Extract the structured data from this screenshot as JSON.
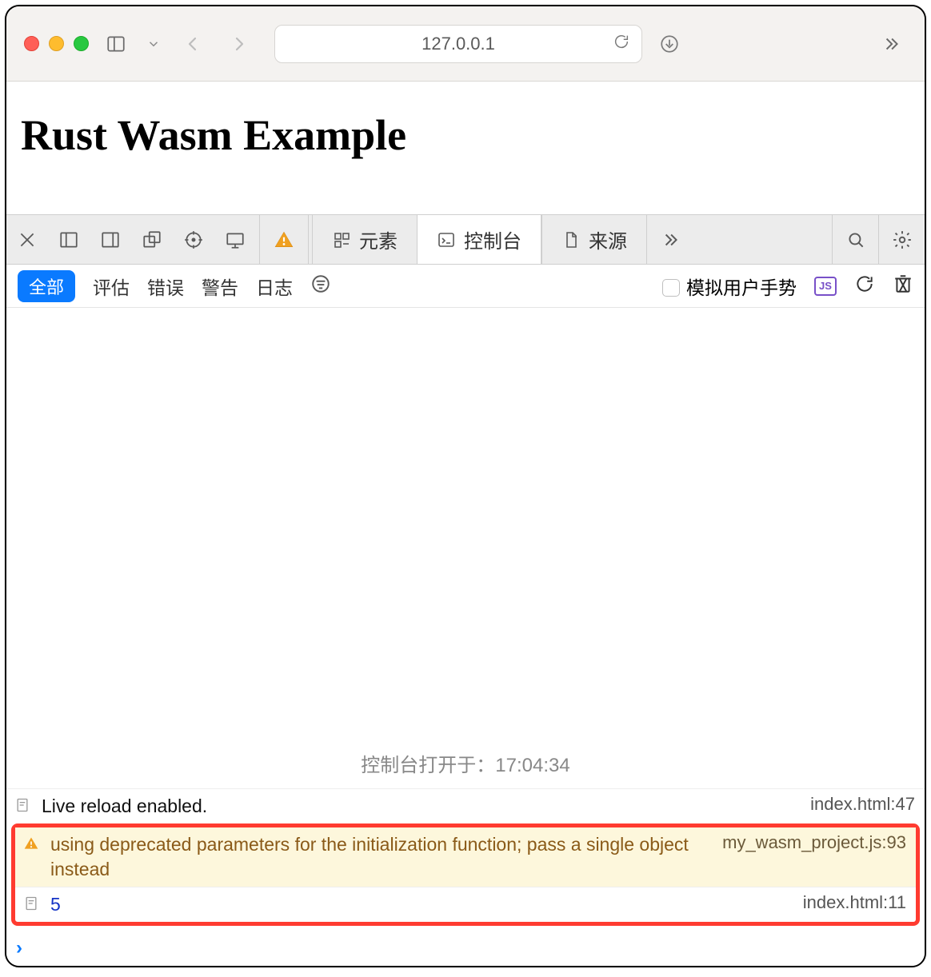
{
  "chrome": {
    "address": "127.0.0.1"
  },
  "page": {
    "heading": "Rust Wasm Example"
  },
  "devtools": {
    "tabs": {
      "elements": "元素",
      "console": "控制台",
      "sources": "来源"
    },
    "filters": {
      "all": "全部",
      "eval": "评估",
      "errors": "错误",
      "warnings": "警告",
      "logs": "日志",
      "gesture_label": "模拟用户手势",
      "js_badge": "JS"
    },
    "console": {
      "opened_label": "控制台打开于：",
      "opened_time": "17:04:34",
      "rows": [
        {
          "kind": "log",
          "msg": "Live reload enabled.",
          "src": "index.html:47"
        },
        {
          "kind": "warn",
          "msg": "using deprecated parameters for the initialization function; pass a single object instead",
          "src": "my_wasm_project.js:93"
        },
        {
          "kind": "out",
          "msg": "5",
          "src": "index.html:11"
        }
      ]
    }
  }
}
